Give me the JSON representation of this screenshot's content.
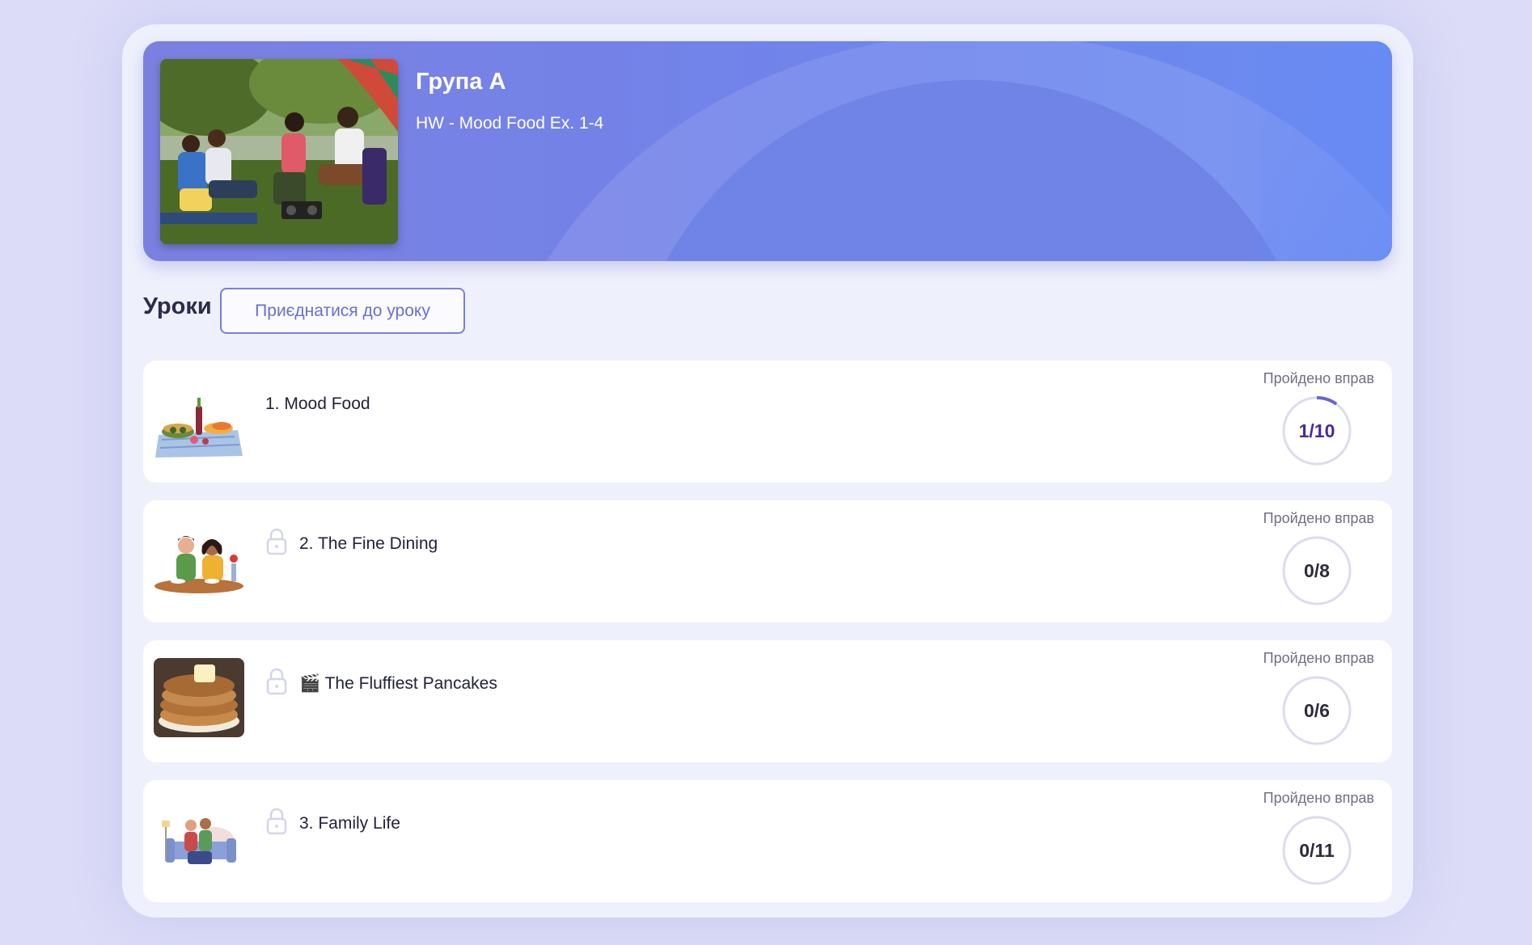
{
  "header": {
    "group_title": "Група А",
    "homework_title": "HW - Mood Food Ex. 1-4"
  },
  "lessons_section": {
    "title": "Уроки",
    "join_button_label": "Приєднатися до уроку"
  },
  "lessons": [
    {
      "title": "1. Mood Food",
      "locked": false,
      "completed_label": "Пройдено вправ",
      "progress_text": "1/10",
      "completed": 1,
      "total": 10,
      "thumbnail": "picnic-illustration"
    },
    {
      "title": "2. The Fine Dining",
      "locked": true,
      "completed_label": "Пройдено вправ",
      "progress_text": "0/8",
      "completed": 0,
      "total": 8,
      "thumbnail": "couple-dining-illustration"
    },
    {
      "title": "🎬 The Fluffiest Pancakes",
      "locked": true,
      "completed_label": "Пройдено вправ",
      "progress_text": "0/6",
      "completed": 0,
      "total": 6,
      "thumbnail": "pancakes-photo"
    },
    {
      "title": "3. Family Life",
      "locked": true,
      "completed_label": "Пройдено вправ",
      "progress_text": "0/11",
      "completed": 0,
      "total": 11,
      "thumbnail": "family-sofa-illustration"
    }
  ],
  "colors": {
    "accent": "#7a7fd8",
    "progress_arc": "#6a62d6",
    "progress_active_text": "#4b2a9a",
    "ring_track": "#dcdcec"
  }
}
